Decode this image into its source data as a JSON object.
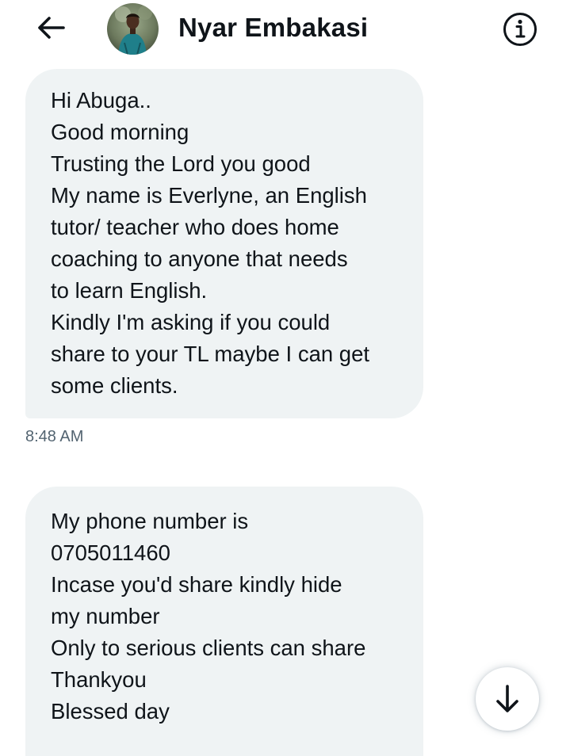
{
  "header": {
    "title": "Nyar Embakasi",
    "back_icon": "arrow-left-icon",
    "info_icon": "info-icon",
    "avatar": "profile-photo"
  },
  "messages": [
    {
      "lines": [
        "Hi Abuga..",
        "Good morning",
        "Trusting the Lord you good",
        "My name is Everlyne, an English",
        "tutor/ teacher who does home",
        "coaching to anyone that needs",
        "to learn English.",
        "Kindly I'm asking if you could",
        "share to your TL maybe I can get",
        "some clients."
      ],
      "timestamp": "8:48 AM"
    },
    {
      "lines": [
        "My phone number is",
        "0705011460",
        "Incase you'd share kindly hide",
        "my number",
        "Only to serious clients can share",
        "Thankyou",
        "Blessed day"
      ]
    }
  ],
  "scroll_button": {
    "icon": "arrow-down-icon"
  },
  "colors": {
    "bubble_bg": "#eff3f4",
    "text": "#0f1419",
    "muted": "#536471"
  }
}
